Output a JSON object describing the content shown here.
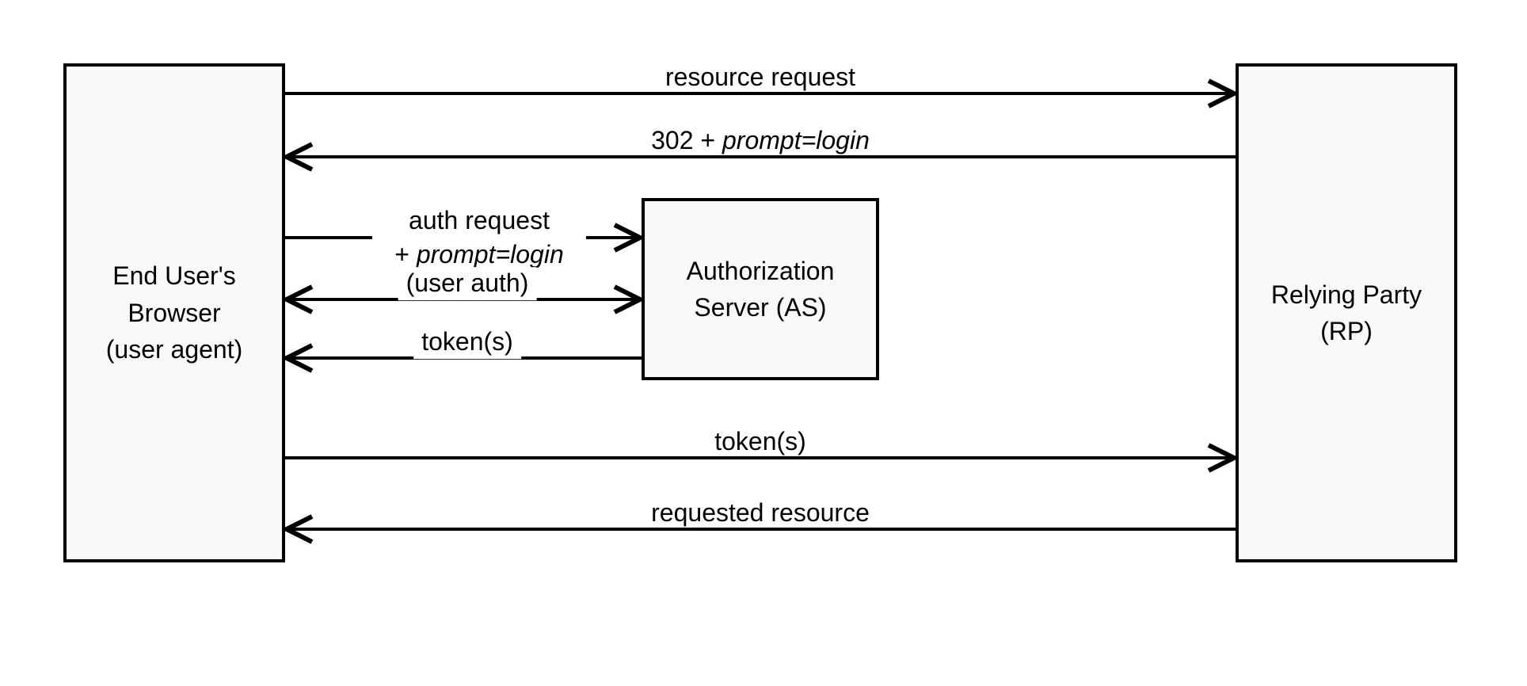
{
  "boxes": {
    "browser": {
      "line1": "End User's",
      "line2": "Browser",
      "line3": "(user agent)"
    },
    "as": {
      "line1": "Authorization",
      "line2": "Server (AS)"
    },
    "rp": {
      "line1": "Relying Party",
      "line2": "(RP)"
    }
  },
  "arrows": {
    "resource_request": "resource request",
    "redirect_prompt_prefix": "302 + ",
    "redirect_prompt_italic": "prompt=login",
    "auth_request_line1": "auth request",
    "auth_request_line2_prefix": "+ ",
    "auth_request_line2_italic": "prompt=login",
    "user_auth": "(user auth)",
    "tokens_as": "token(s)",
    "tokens_rp": "token(s)",
    "requested_resource": "requested resource"
  }
}
